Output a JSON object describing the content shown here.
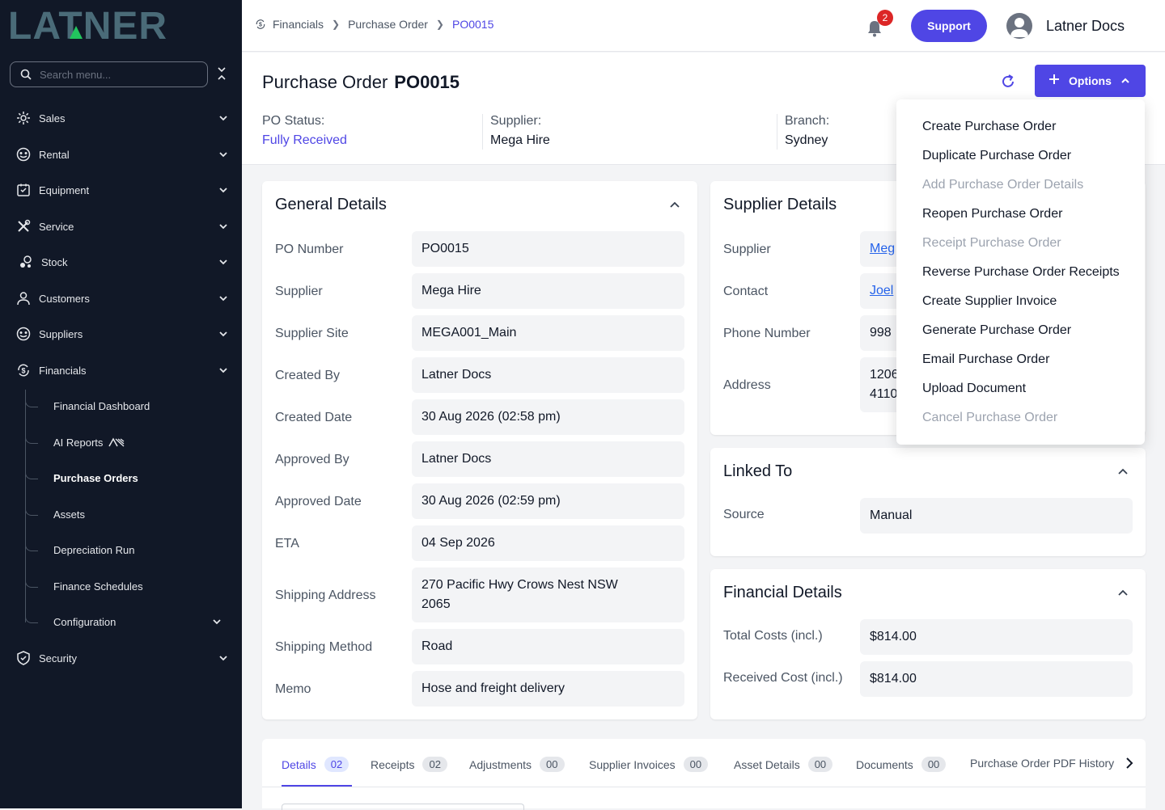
{
  "app": {
    "brand": "LATNER"
  },
  "sidebar": {
    "search_placeholder": "Search menu...",
    "items": [
      {
        "label": "Sales",
        "icon": "sales-icon"
      },
      {
        "label": "Rental",
        "icon": "rental-icon"
      },
      {
        "label": "Equipment",
        "icon": "equipment-icon"
      },
      {
        "label": "Service",
        "icon": "service-icon"
      },
      {
        "label": "Stock",
        "icon": "stock-icon"
      },
      {
        "label": "Customers",
        "icon": "customers-icon"
      },
      {
        "label": "Suppliers",
        "icon": "suppliers-icon"
      },
      {
        "label": "Financials",
        "icon": "financials-icon"
      }
    ],
    "financials_sub": [
      {
        "label": "Financial Dashboard"
      },
      {
        "label": "AI Reports"
      },
      {
        "label": "Purchase Orders",
        "active": true
      },
      {
        "label": "Assets"
      },
      {
        "label": "Depreciation Run"
      },
      {
        "label": "Finance Schedules"
      },
      {
        "label": "Configuration"
      }
    ],
    "security": {
      "label": "Security",
      "icon": "security-icon"
    }
  },
  "topbar": {
    "breadcrumb": [
      "Financials",
      "Purchase Order",
      "PO0015"
    ],
    "notifications": "2",
    "support_label": "Support",
    "user_name": "Latner Docs"
  },
  "header": {
    "title": "Purchase Order",
    "po_number": "PO0015",
    "options_label": "Options",
    "status_label": "PO Status:",
    "status_value": "Fully Received",
    "supplier_label": "Supplier:",
    "supplier_value": "Mega Hire",
    "branch_label": "Branch:",
    "branch_value": "Sydney"
  },
  "general": {
    "title": "General Details",
    "rows": [
      {
        "label": "PO Number",
        "value": "PO0015"
      },
      {
        "label": "Supplier",
        "value": "Mega Hire"
      },
      {
        "label": "Supplier Site",
        "value": "MEGA001_Main"
      },
      {
        "label": "Created By",
        "value": "Latner Docs"
      },
      {
        "label": "Created Date",
        "value": "30 Aug 2026 (02:58 pm)"
      },
      {
        "label": "Approved By",
        "value": "Latner Docs"
      },
      {
        "label": "Approved Date",
        "value": "30 Aug 2026 (02:59 pm)"
      },
      {
        "label": "ETA",
        "value": "04 Sep 2026"
      },
      {
        "label": "Shipping Address",
        "value": "270 Pacific Hwy Crows Nest NSW 2065"
      },
      {
        "label": "Shipping Method",
        "value": "Road"
      },
      {
        "label": "Memo",
        "value": "Hose and freight delivery"
      }
    ]
  },
  "supplier": {
    "title": "Supplier Details",
    "rows": [
      {
        "label": "Supplier",
        "value": "Meg"
      },
      {
        "label": "Contact",
        "value": "Joel"
      },
      {
        "label": "Phone Number",
        "value": "998"
      },
      {
        "label": "Address",
        "value_1": "1206",
        "value_2": "4110"
      }
    ]
  },
  "linked": {
    "title": "Linked To",
    "rows": [
      {
        "label": "Source",
        "value": "Manual"
      }
    ]
  },
  "financial": {
    "title": "Financial Details",
    "rows": [
      {
        "label": "Total Costs (incl.)",
        "value": "$814.00"
      },
      {
        "label": "Received Cost (incl.)",
        "value": "$814.00"
      }
    ]
  },
  "options_menu": [
    {
      "label": "Create Purchase Order",
      "disabled": false
    },
    {
      "label": "Duplicate Purchase Order",
      "disabled": false
    },
    {
      "label": "Add Purchase Order Details",
      "disabled": true
    },
    {
      "label": "Reopen Purchase Order",
      "disabled": false
    },
    {
      "label": "Receipt Purchase Order",
      "disabled": true
    },
    {
      "label": "Reverse Purchase Order Receipts",
      "disabled": false
    },
    {
      "label": "Create Supplier Invoice",
      "disabled": false
    },
    {
      "label": "Generate Purchase Order",
      "disabled": false
    },
    {
      "label": "Email Purchase Order",
      "disabled": false
    },
    {
      "label": "Upload Document",
      "disabled": false
    },
    {
      "label": "Cancel Purchase Order",
      "disabled": true
    }
  ],
  "tabs": [
    {
      "label": "Details",
      "count": "02",
      "active": true
    },
    {
      "label": "Receipts",
      "count": "02"
    },
    {
      "label": "Adjustments",
      "count": "00"
    },
    {
      "label": "Supplier Invoices",
      "count": "00"
    },
    {
      "label": "Asset Details",
      "count": "00"
    },
    {
      "label": "Documents",
      "count": "00"
    },
    {
      "label": "Purchase Order PDF History"
    }
  ],
  "colors": {
    "accent": "#4f46e5",
    "sidebar": "#111827",
    "danger": "#dc2626"
  }
}
